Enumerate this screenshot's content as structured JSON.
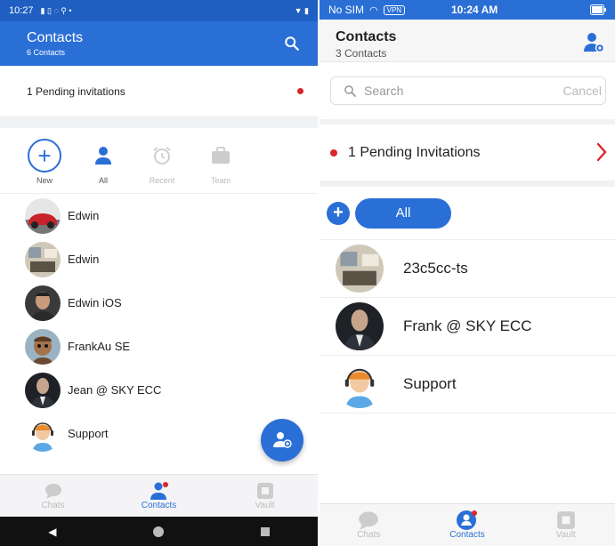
{
  "android": {
    "status": {
      "time": "10:27"
    },
    "title": "Contacts",
    "subtitle": "6 Contacts",
    "pending": "1 Pending invitations",
    "actions": [
      {
        "label": "New"
      },
      {
        "label": "All"
      },
      {
        "label": "Recent"
      },
      {
        "label": "Team"
      }
    ],
    "contacts": [
      {
        "name": "Edwin",
        "avatar": "car-avatar"
      },
      {
        "name": "Edwin",
        "avatar": "room-avatar"
      },
      {
        "name": "Edwin iOS",
        "avatar": "man-avatar"
      },
      {
        "name": "FrankAu SE",
        "avatar": "cartoon-avatar"
      },
      {
        "name": "Jean @ SKY ECC",
        "avatar": "suit-avatar"
      },
      {
        "name": "Support",
        "avatar": "support-avatar"
      }
    ],
    "tabs": [
      {
        "label": "Chats"
      },
      {
        "label": "Contacts"
      },
      {
        "label": "Vault"
      }
    ]
  },
  "ios": {
    "status": {
      "carrier": "No SIM",
      "vpn": "VPN",
      "time": "10:24 AM"
    },
    "title": "Contacts",
    "subtitle": "3 Contacts",
    "search": {
      "placeholder": "Search",
      "cancel": "Cancel"
    },
    "pending": "1 Pending Invitations",
    "filter": {
      "all": "All"
    },
    "contacts": [
      {
        "name": "23c5cc-ts",
        "avatar": "room-avatar"
      },
      {
        "name": "Frank @ SKY ECC",
        "avatar": "suit-avatar"
      },
      {
        "name": "Support",
        "avatar": "support-avatar"
      }
    ],
    "tabs": [
      {
        "label": "Chats"
      },
      {
        "label": "Contacts"
      },
      {
        "label": "Vault"
      }
    ]
  },
  "colors": {
    "accent": "#2a6fd6",
    "badge": "#d9262b"
  }
}
